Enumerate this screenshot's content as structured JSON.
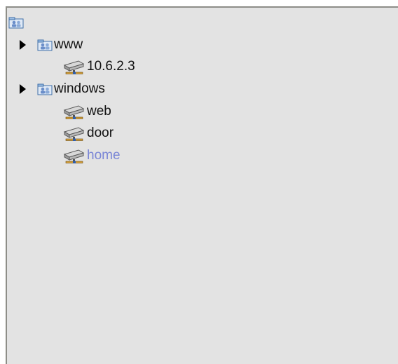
{
  "colors": {
    "panel_bg": "#e3e3e3",
    "panel_border": "#8e8e88",
    "text": "#111111",
    "link_text": "#7a86d6"
  },
  "tree": {
    "root": {
      "icon": "group-folder-icon",
      "label": ""
    },
    "groups": [
      {
        "expanded": true,
        "icon": "group-folder-icon",
        "label": "www",
        "children": [
          {
            "icon": "network-server-icon",
            "label": "10.6.2.3"
          }
        ]
      },
      {
        "expanded": true,
        "icon": "group-folder-icon",
        "label": "windows",
        "children": [
          {
            "icon": "network-server-icon",
            "label": "web"
          },
          {
            "icon": "network-server-icon",
            "label": "door"
          },
          {
            "icon": "network-server-icon",
            "label": "home",
            "style": "link"
          }
        ]
      }
    ]
  }
}
